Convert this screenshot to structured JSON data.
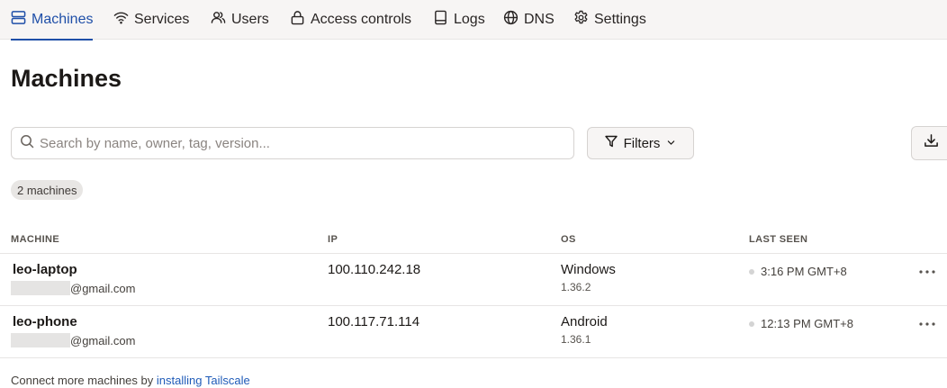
{
  "nav": {
    "items": [
      {
        "label": "Machines",
        "icon": "server-icon",
        "active": true
      },
      {
        "label": "Services",
        "icon": "wifi-icon"
      },
      {
        "label": "Users",
        "icon": "users-icon"
      },
      {
        "label": "Access controls",
        "icon": "lock-icon"
      },
      {
        "label": "Logs",
        "icon": "book-icon"
      },
      {
        "label": "DNS",
        "icon": "globe-icon"
      },
      {
        "label": "Settings",
        "icon": "gear-icon"
      }
    ],
    "active_color": "#1f4fa8"
  },
  "page": {
    "title": "Machines"
  },
  "search": {
    "placeholder": "Search by name, owner, tag, version...",
    "value": ""
  },
  "toolbar": {
    "filters_label": "Filters",
    "export_icon": "download-icon"
  },
  "count_badge": "2 machines",
  "table": {
    "columns": [
      "MACHINE",
      "IP",
      "OS",
      "LAST SEEN"
    ],
    "rows": [
      {
        "name": "leo-laptop",
        "owner_suffix": "@gmail.com",
        "ip": "100.110.242.18",
        "os": "Windows",
        "os_version": "1.36.2",
        "last_seen": "3:16 PM GMT+8"
      },
      {
        "name": "leo-phone",
        "owner_suffix": "@gmail.com",
        "ip": "100.117.71.114",
        "os": "Android",
        "os_version": "1.36.1",
        "last_seen": "12:13 PM GMT+8"
      }
    ]
  },
  "footer": {
    "text": "Connect more machines by",
    "link_label": "installing Tailscale"
  }
}
